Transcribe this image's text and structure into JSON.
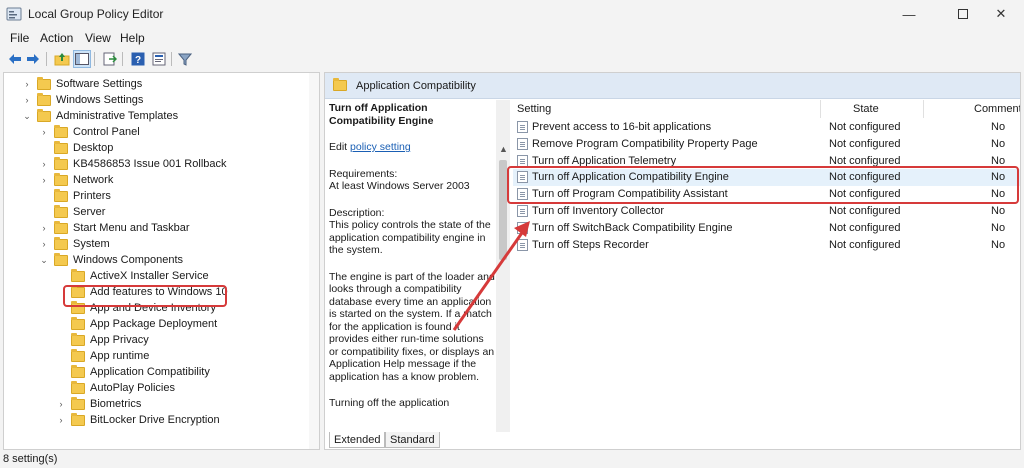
{
  "window": {
    "title": "Local Group Policy Editor",
    "minimize_icon": "minimize-icon",
    "maximize_icon": "maximize-icon",
    "close_icon": "close-icon"
  },
  "menu": [
    "File",
    "Action",
    "View",
    "Help"
  ],
  "toolbar_icons": [
    "back-icon",
    "forward-icon",
    "up-folder-icon",
    "show-hide-tree-icon",
    "export-list-icon",
    "help-icon",
    "properties-icon",
    "filter-icon"
  ],
  "tree": [
    {
      "label": "Software Settings",
      "arrow": "›",
      "level": 0
    },
    {
      "label": "Windows Settings",
      "arrow": "›",
      "level": 0
    },
    {
      "label": "Administrative Templates",
      "arrow": "⌄",
      "level": 0
    },
    {
      "label": "Control Panel",
      "arrow": "›",
      "level": 1
    },
    {
      "label": "Desktop",
      "arrow": "",
      "level": 1
    },
    {
      "label": "KB4586853 Issue 001 Rollback",
      "arrow": "›",
      "level": 1
    },
    {
      "label": "Network",
      "arrow": "›",
      "level": 1
    },
    {
      "label": "Printers",
      "arrow": "",
      "level": 1
    },
    {
      "label": "Server",
      "arrow": "",
      "level": 1
    },
    {
      "label": "Start Menu and Taskbar",
      "arrow": "›",
      "level": 1
    },
    {
      "label": "System",
      "arrow": "›",
      "level": 1
    },
    {
      "label": "Windows Components",
      "arrow": "⌄",
      "level": 1
    },
    {
      "label": "ActiveX Installer Service",
      "arrow": "",
      "level": 2
    },
    {
      "label": "Add features to Windows 10",
      "arrow": "",
      "level": 2
    },
    {
      "label": "App and Device Inventory",
      "arrow": "",
      "level": 2
    },
    {
      "label": "App Package Deployment",
      "arrow": "",
      "level": 2
    },
    {
      "label": "App Privacy",
      "arrow": "",
      "level": 2
    },
    {
      "label": "App runtime",
      "arrow": "",
      "level": 2
    },
    {
      "label": "Application Compatibility",
      "arrow": "",
      "level": 2
    },
    {
      "label": "AutoPlay Policies",
      "arrow": "",
      "level": 2
    },
    {
      "label": "Biometrics",
      "arrow": "›",
      "level": 2
    },
    {
      "label": "BitLocker Drive Encryption",
      "arrow": "›",
      "level": 2
    }
  ],
  "pane": {
    "title": "Application Compatibility",
    "desc_title": "Turn off Application Compatibility Engine",
    "edit_prefix": "Edit",
    "edit_link": "policy setting",
    "requirements_label": "Requirements:",
    "requirements_value": "At least Windows Server 2003",
    "description_label": "Description:",
    "description_1": " This policy controls the state of the application compatibility engine in the system.",
    "description_2": "The engine is part of the loader and looks through a compatibility database every time an application is started on the system.  If a match for the application is found it provides either run-time solutions or compatibility fixes, or displays an Application Help message if the application has a know problem.",
    "description_3": "Turning off the application"
  },
  "columns": {
    "setting": "Setting",
    "state": "State",
    "comment": "Comment"
  },
  "rows": [
    {
      "name": "Prevent access to 16-bit applications",
      "state": "Not configured",
      "comment": "No"
    },
    {
      "name": "Remove Program Compatibility Property Page",
      "state": "Not configured",
      "comment": "No"
    },
    {
      "name": "Turn off Application Telemetry",
      "state": "Not configured",
      "comment": "No"
    },
    {
      "name": "Turn off Application Compatibility Engine",
      "state": "Not configured",
      "comment": "No"
    },
    {
      "name": "Turn off Program Compatibility Assistant",
      "state": "Not configured",
      "comment": "No"
    },
    {
      "name": "Turn off Inventory Collector",
      "state": "Not configured",
      "comment": "No"
    },
    {
      "name": "Turn off SwitchBack Compatibility Engine",
      "state": "Not configured",
      "comment": "No"
    },
    {
      "name": "Turn off Steps Recorder",
      "state": "Not configured",
      "comment": "No"
    }
  ],
  "tabs": [
    "Extended",
    "Standard"
  ],
  "status": "8 setting(s)",
  "colors": {
    "highlight": "#d63a3a",
    "selection": "#e5f1fb",
    "header": "#dfe9f5"
  }
}
